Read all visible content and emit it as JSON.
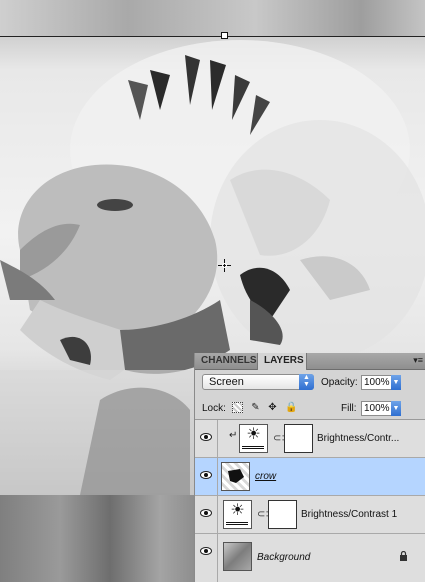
{
  "panel": {
    "tabs": [
      "CHANNELS",
      "LAYERS"
    ],
    "active_tab": "LAYERS",
    "blend_mode": "Screen",
    "opacity_label": "Opacity:",
    "opacity_value": "100%",
    "lock_label": "Lock:",
    "fill_label": "Fill:",
    "fill_value": "100%"
  },
  "layers": [
    {
      "name": "Brightness/Contr...",
      "type": "adjustment",
      "clipped": true,
      "selected": false,
      "visible": true
    },
    {
      "name": "crow",
      "type": "pixel",
      "clipped": false,
      "selected": true,
      "visible": true
    },
    {
      "name": "Brightness/Contrast 1",
      "type": "adjustment",
      "clipped": false,
      "selected": false,
      "visible": true
    },
    {
      "name": "Background",
      "type": "background",
      "clipped": false,
      "selected": false,
      "visible": true,
      "locked": true
    }
  ],
  "icons": {
    "eye": "eye-icon",
    "adjustment": "brightness-contrast-icon",
    "link": "chain-link-icon",
    "lock": "lock-icon",
    "move": "move-icon",
    "brush": "brush-icon",
    "transparency": "transparency-lock-icon"
  },
  "colors": {
    "selection": "#b5d5ff",
    "accent": "#2f6fd1"
  }
}
